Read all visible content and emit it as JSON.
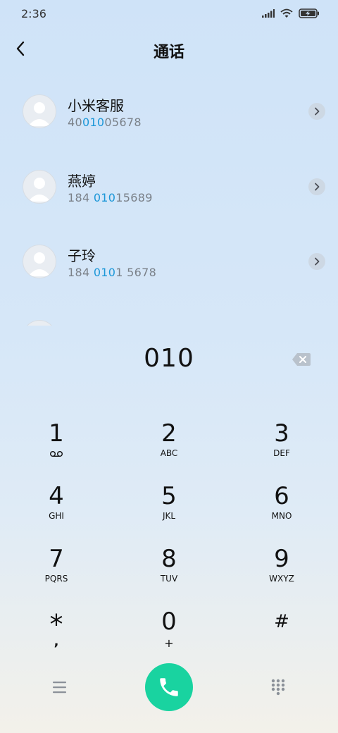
{
  "status": {
    "time": "2:36"
  },
  "header": {
    "title": "通话"
  },
  "contacts": [
    {
      "name": "小米客服",
      "number_parts": [
        "40",
        "010",
        "05678"
      ]
    },
    {
      "name": "燕婷",
      "number_parts": [
        "184 ",
        "010",
        "15689"
      ]
    },
    {
      "name": "子玲",
      "number_parts": [
        "184 ",
        "010",
        "1 5678"
      ]
    }
  ],
  "dialer": {
    "number": "010",
    "keys": [
      {
        "digit": "1",
        "letters": ""
      },
      {
        "digit": "2",
        "letters": "ABC"
      },
      {
        "digit": "3",
        "letters": "DEF"
      },
      {
        "digit": "4",
        "letters": "GHI"
      },
      {
        "digit": "5",
        "letters": "JKL"
      },
      {
        "digit": "6",
        "letters": "MNO"
      },
      {
        "digit": "7",
        "letters": "PQRS"
      },
      {
        "digit": "8",
        "letters": "TUV"
      },
      {
        "digit": "9",
        "letters": "WXYZ"
      },
      {
        "digit": "*",
        "letters": ","
      },
      {
        "digit": "0",
        "letters": "+"
      },
      {
        "digit": "#",
        "letters": ""
      }
    ]
  },
  "colors": {
    "highlight": "#1c97d8",
    "call": "#19d3a0"
  },
  "icons": [
    "signal-icon",
    "wifi-icon",
    "battery-charging-icon",
    "back-arrow-icon",
    "chevron-right-icon",
    "backspace-icon",
    "voicemail-icon",
    "menu-icon",
    "phone-icon",
    "keypad-grid-icon"
  ]
}
